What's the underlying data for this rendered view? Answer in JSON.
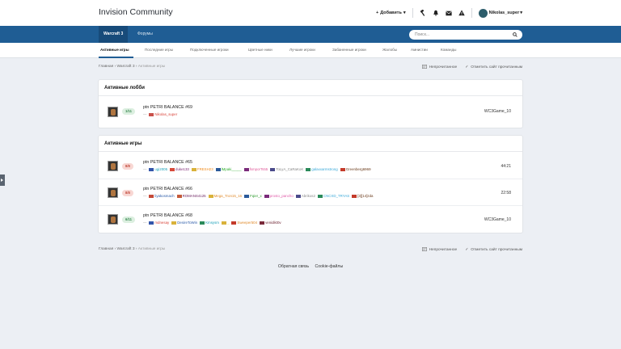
{
  "header": {
    "brand": "Invision Community",
    "add_label": "Добавить",
    "username": "Nikolas_super"
  },
  "nav": {
    "tabs": [
      "Warcraft 3",
      "Форумы"
    ],
    "search_placeholder": "Поиск..."
  },
  "subnav": {
    "items": [
      "Активные игры",
      "Последние игры",
      "Подключенные игроки",
      "Цветные ники",
      "Лучшие игроки",
      "Забаненные игроки",
      "Жалобы",
      "Амнистии",
      "Команды"
    ]
  },
  "breadcrumb": {
    "home": "Главная",
    "section": "Warcraft 3",
    "current": "Активные игры",
    "unread": "Непрочитанное",
    "mark_read": "Отметить сайт прочитанным"
  },
  "lobbies": {
    "title": "Активные лобби",
    "rows": [
      {
        "slots": "1/11",
        "name": "ptn PETRI BALANCE #69",
        "players": [
          {
            "name": "Nikolas_super",
            "color": "#d9443a",
            "flag": "#c9514a"
          }
        ],
        "right": "WC3Game_10"
      }
    ]
  },
  "games": {
    "title": "Активные игры",
    "rows": [
      {
        "slots": "8/8",
        "name": "ptn PETRI BALANCE #65",
        "players": [
          {
            "name": "ugi2005",
            "color": "#1aa0b8",
            "flag": "#3355aa"
          },
          {
            "name": "duke133",
            "color": "#7a1f6e",
            "flag": "#d74a3a"
          },
          {
            "name": "FRESH23",
            "color": "#f08a1a",
            "flag": "#d9b23a"
          },
          {
            "name": "lMpaki_____",
            "color": "#2fae2f",
            "flag": "#2a5a9a"
          },
          {
            "name": "fsmporTs55",
            "color": "#e05a9a",
            "flag": "#7a2a7a"
          },
          {
            "name": "ToLyA_CaRaKoK",
            "color": "#888888",
            "flag": "#4a4a8a"
          },
          {
            "name": "galaxxarmstrong",
            "color": "#38a8d8",
            "flag": "#2a8a5a"
          },
          {
            "name": "Greenberg6969",
            "color": "#6a3a1a",
            "flag": "#c43a2a"
          }
        ],
        "right": "44:21"
      },
      {
        "slots": "8/8",
        "name": "ptn PETRI BALANCE #66",
        "players": [
          {
            "name": "liyakosmach",
            "color": "#2a5aa8",
            "flag": "#c44a3a"
          },
          {
            "name": "ROMANS4125",
            "color": "#6a1f5e",
            "flag": "#c45a3a"
          },
          {
            "name": "Mega_Tron15_16",
            "color": "#e08a2a",
            "flag": "#d9b23a"
          },
          {
            "name": "Fqier_x",
            "color": "#2a9a2a",
            "flag": "#2a5a9a"
          },
          {
            "name": "prosto_pancho",
            "color": "#e05aa8",
            "flag": "#7a2a7a"
          },
          {
            "name": "Abrikos2",
            "color": "#888888",
            "flag": "#4a4a8a"
          },
          {
            "name": "CNCXD_TRYAS",
            "color": "#38a8d8",
            "flag": "#2a8a5a"
          },
          {
            "name": "[3][14]zda",
            "color": "#6a3a1a",
            "flag": "#c43a2a"
          }
        ],
        "right": "22:58"
      },
      {
        "slots": "6/11",
        "name": "ptn PETRI BALANCE #68",
        "players": [
          {
            "name": "mdnesay",
            "color": "#d9443a",
            "flag": "#3355aa"
          },
          {
            "name": "DesireToWin",
            "color": "#2a5aa8",
            "flag": "#d9b23a"
          },
          {
            "name": "Kmsysm",
            "color": "#1aa0b8",
            "flag": "#2a8a5a"
          },
          {
            "name": "_",
            "color": "#e8d63a",
            "flag": "#d9b23a"
          },
          {
            "name": "Sweeper504",
            "color": "#e08a2a",
            "flag": "#c43a2a"
          },
          {
            "name": "venidikt0v",
            "color": "#6a1f2e",
            "flag": "#7a2a3a"
          }
        ],
        "right": "WC3Game_10"
      }
    ]
  },
  "footer": {
    "links": [
      "Обратная связь",
      "Cookie-файлы"
    ]
  }
}
